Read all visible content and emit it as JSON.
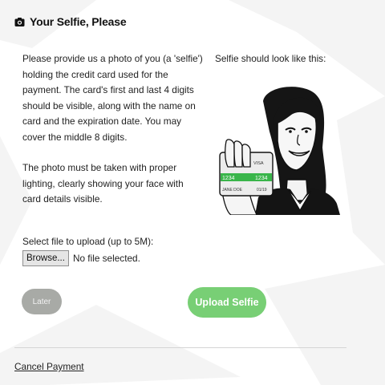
{
  "header": {
    "title": "Your Selfie, Please",
    "icon": "camera-icon"
  },
  "instructions": {
    "paragraph_1": "Please provide us a photo of you (a 'selfie') holding the credit card used for the payment. The card's first and last 4 digits should be visible, along with the name on card and the expiration date. You may cover the middle 8 digits.",
    "paragraph_2": "The photo must be taken with proper lighting, clearly showing your face with card details visible."
  },
  "sample": {
    "label": "Selfie should look like this:",
    "card": {
      "brand": "VISA",
      "first_digits": "1234",
      "last_digits": "1234",
      "name": "JANE DOE",
      "expiry": "01/19"
    }
  },
  "upload": {
    "label": "Select file to upload (up to 5M):",
    "browse_label": "Browse...",
    "status": "No file selected."
  },
  "actions": {
    "later_label": "Later",
    "upload_label": "Upload Selfie",
    "cancel_label": "Cancel Payment"
  },
  "colors": {
    "upload_button": "#78cf75",
    "later_button": "#a8aaa6",
    "card_stripe": "#39b54a"
  }
}
